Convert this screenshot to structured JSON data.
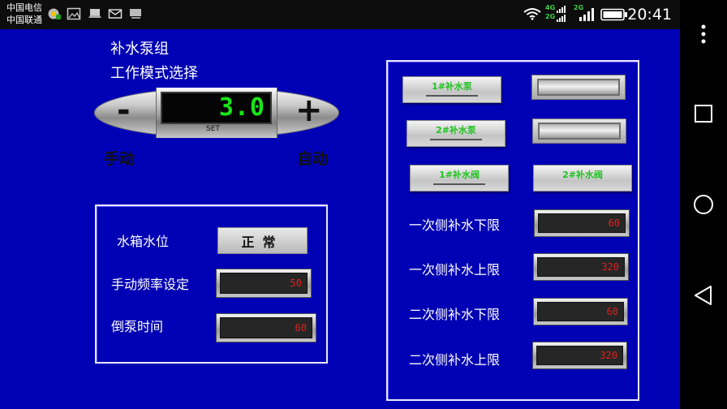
{
  "statusbar": {
    "carrier_line1": "中国电信",
    "carrier_line2": "中国联通",
    "net1": "4G",
    "net2": "2G",
    "net3": "2G",
    "time": "20:41",
    "icons": [
      "sync-icon",
      "image-icon",
      "laptop-icon",
      "mail-icon",
      "monitor-icon",
      "wifi-icon",
      "signal-icon",
      "battery-icon"
    ]
  },
  "navbar": {
    "icons": [
      "more-icon",
      "recent-apps-icon",
      "home-icon",
      "back-icon"
    ]
  },
  "left": {
    "group_title": "补水泵组",
    "mode_title": "工作模式选择",
    "spinner": {
      "minus": "-",
      "plus": "+",
      "value": "3.0",
      "set_label": "SET"
    },
    "manual_label": "手动",
    "auto_label": "自动",
    "panel": {
      "water_level_label": "水箱水位",
      "water_level_status": "正常",
      "manual_freq_label": "手动频率设定",
      "manual_freq_value": "50",
      "switch_time_label": "倒泵时间",
      "switch_time_value": "60"
    }
  },
  "right": {
    "pump1": "1#补水泵",
    "pump2": "2#补水泵",
    "valve1": "1#补水阀",
    "valve2": "2#补水阀",
    "rows": [
      {
        "label": "一次侧补水下限",
        "value": "60"
      },
      {
        "label": "一次侧补水上限",
        "value": "320"
      },
      {
        "label": "二次侧补水下限",
        "value": "60"
      },
      {
        "label": "二次侧补水上限",
        "value": "320"
      }
    ]
  },
  "colors": {
    "background": "#0000b4",
    "lcd_green": "#19e619",
    "lcd_red": "#e02020",
    "button_text_green": "#1fc21f"
  }
}
